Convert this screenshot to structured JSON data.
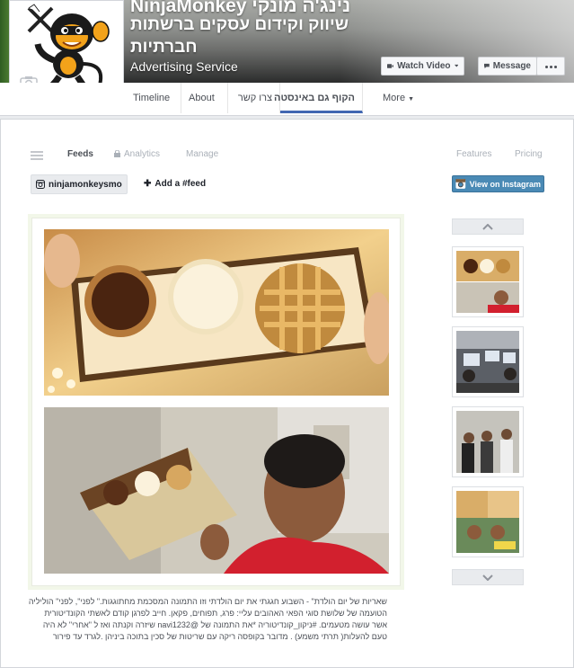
{
  "page": {
    "name": "NinjaMonkey ",
    "name_hebrew": "נינג'ה מונקי",
    "tagline": "שיווק וקידום עסקים ברשתות",
    "tagline_2": "חברתיות",
    "category": "Advertising Service"
  },
  "cover_buttons": {
    "watch_video": "Watch Video",
    "message": "Message"
  },
  "tabs": [
    {
      "label": "Timeline",
      "active": false
    },
    {
      "label": "About",
      "active": false
    },
    {
      "label": "צרו קשר",
      "active": false
    },
    {
      "label": "הקוף גם באינסטה",
      "active": true
    },
    {
      "label": "More",
      "active": false
    }
  ],
  "app": {
    "links": {
      "feeds": "Feeds",
      "analytics": "Analytics",
      "manage": "Manage",
      "features": "Features",
      "pricing": "Pricing"
    },
    "feed_account": "ninjamonkeysmo",
    "add_feed": "Add a #feed",
    "view_on_instagram": "View on Instagram"
  },
  "post": {
    "caption": "שאריות של יום הולדת\" - השבוע חגגתי את יום הולדתי וזו התמונה המסכמת מחתוגגות.\" לפני\", לפני\" הוליליה הטועמה של שלושת סוגי הפאי האהובים עליי: פרג, תפוחים, פקאן. חייב לפרגן קודם לאשתי הקונדיטורית אשר עושה מטעמים. #ניקון_קונדיטוריה *את התמונה של @navi1232 שיזרה וקנתה ואז ל \"אחרי\" לא היה טעם להעלות( תרתי משמע) . מדובר בקופסה ריקה עם שריטות של סכין בתוכה ביניהן .לגרד עד פירור"
  },
  "colors": {
    "accent": "#4267b2",
    "instagram_button": "#4a8ab5",
    "page_bg": "#e9ebee"
  },
  "icons": [
    "camera-icon",
    "video-icon",
    "message-icon",
    "more-dots-icon",
    "menu-icon",
    "lock-icon",
    "instagram-icon",
    "plus-icon",
    "chevron-up-icon",
    "chevron-down-icon"
  ]
}
